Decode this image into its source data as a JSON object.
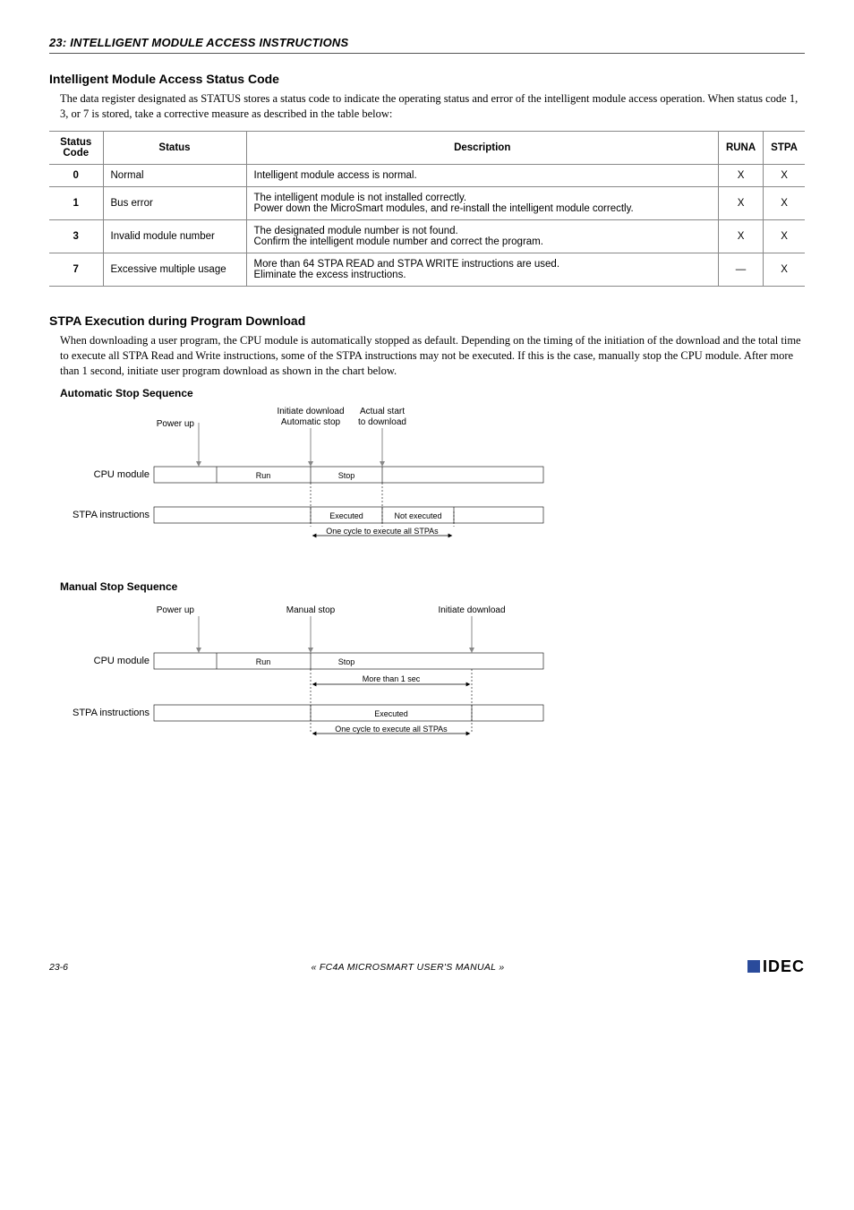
{
  "chapter": "23: INTELLIGENT MODULE ACCESS INSTRUCTIONS",
  "s1": {
    "title": "Intelligent Module Access Status Code",
    "para": "The data register designated as STATUS stores a status code to indicate the operating status and error of the intelligent module access operation. When status code 1, 3, or 7 is stored, take a corrective measure as described in the table below:",
    "th": {
      "code": "Status Code",
      "status": "Status",
      "desc": "Description",
      "runa": "RUNA",
      "stpa": "STPA"
    },
    "rows": {
      "r0": {
        "code": "0",
        "status": "Normal",
        "desc": "Intelligent module access is normal.",
        "runa": "X",
        "stpa": "X"
      },
      "r1": {
        "code": "1",
        "status": "Bus error",
        "desc": "The intelligent module is not installed correctly.\nPower down the MicroSmart modules, and re-install the intelligent module correctly.",
        "runa": "X",
        "stpa": "X"
      },
      "r3": {
        "code": "3",
        "status": "Invalid module number",
        "desc": "The designated module number is not found.\nConfirm the intelligent module number and correct the program.",
        "runa": "X",
        "stpa": "X"
      },
      "r7": {
        "code": "7",
        "status": "Excessive multiple usage",
        "desc": "More than 64 STPA READ and STPA WRITE instructions are used.\nEliminate the excess instructions.",
        "runa": "—",
        "stpa": "X"
      }
    }
  },
  "s2": {
    "title": "STPA Execution during Program Download",
    "para": "When downloading a user program, the CPU module is automatically stopped as default. Depending on the timing of the initiation of the download and the total time to execute all STPA Read and Write instructions, some of the STPA instructions may not be executed. If this is the case, manually stop the CPU module. After more than 1 second, initiate user program download as shown in the chart below."
  },
  "d1": {
    "title": "Automatic Stop Sequence",
    "power_up": "Power up",
    "init_dl": "Initiate download",
    "auto_stop": "Automatic stop",
    "actual_start": "Actual start",
    "to_dl": "to download",
    "cpu": "CPU module",
    "stpa": "STPA instructions",
    "run": "Run",
    "stop": "Stop",
    "exec": "Executed",
    "noexec": "Not executed",
    "cycle": "One cycle to execute all STPAs"
  },
  "d2": {
    "title": "Manual Stop Sequence",
    "power_up": "Power up",
    "manual_stop": "Manual stop",
    "init_dl": "Initiate download",
    "cpu": "CPU module",
    "stpa": "STPA instructions",
    "run": "Run",
    "stop": "Stop",
    "more1s": "More than 1 sec",
    "exec": "Executed",
    "cycle": "One cycle to execute all STPAs"
  },
  "footer": {
    "page": "23-6",
    "center": "« FC4A MICROSMART USER'S MANUAL »",
    "logo": "IDEC"
  }
}
